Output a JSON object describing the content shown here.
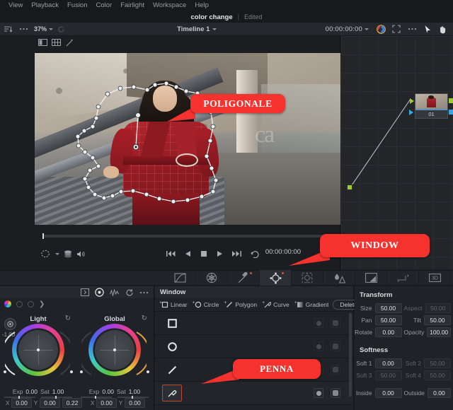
{
  "menubar": {
    "items": [
      {
        "label": "View"
      },
      {
        "label": "Playback"
      },
      {
        "label": "Fusion"
      },
      {
        "label": "Color"
      },
      {
        "label": "Fairlight"
      },
      {
        "label": "Workspace"
      },
      {
        "label": "Help"
      }
    ]
  },
  "titlebar": {
    "project_name": "color change",
    "separator": "|",
    "state": "Edited"
  },
  "toolbar": {
    "zoom_level": "37%",
    "timeline_name": "Timeline 1",
    "timecode": "00:00:00:00"
  },
  "viewer": {
    "timecode": "00:00:00:00",
    "annotations": [
      {
        "id": "poligonale",
        "label": "POLIGONALE",
        "color": "#f6322e"
      },
      {
        "id": "window",
        "label": "WINDOW",
        "color": "#f6322e"
      },
      {
        "id": "penna",
        "label": "PENNA",
        "color": "#f6322e"
      }
    ],
    "store_sign": "ca"
  },
  "nodes": {
    "items": [
      {
        "label": "01"
      }
    ]
  },
  "palette_tools": [
    {
      "name": "curves-tool",
      "active": false,
      "badge": false
    },
    {
      "name": "color-warper-tool",
      "active": false,
      "badge": false
    },
    {
      "name": "qualifier-tool",
      "active": false,
      "badge": true
    },
    {
      "name": "window-tool",
      "active": true,
      "badge": true
    },
    {
      "name": "tracker-tool",
      "active": false,
      "badge": false
    },
    {
      "name": "blur-tool",
      "active": false,
      "badge": false
    },
    {
      "name": "key-tool",
      "active": false,
      "badge": false
    },
    {
      "name": "sizing-tool",
      "active": false,
      "badge": false
    },
    {
      "name": "stereo-3d-tool",
      "active": false,
      "badge": false
    }
  ],
  "color_wheels": {
    "wheels": [
      {
        "name": "Light",
        "lift_value": "-1.00",
        "exp_label": "Exp",
        "exp_value": "0.00",
        "sat_label": "Sat",
        "sat_value": "1.00",
        "x_label": "X",
        "x_value": "0.00",
        "y_label": "Y",
        "y_value": "0.00",
        "extra_value": "0.22"
      },
      {
        "name": "Global",
        "lift_value": "",
        "exp_label": "Exp",
        "exp_value": "0.00",
        "sat_label": "Sat",
        "sat_value": "1.00",
        "x_label": "X",
        "x_value": "0.00",
        "y_label": "Y",
        "y_value": "0.00",
        "extra_value": ""
      }
    ]
  },
  "window_panel": {
    "title": "Window",
    "shape_buttons": [
      {
        "label": "Linear",
        "icon": "square-icon"
      },
      {
        "label": "Circle",
        "icon": "circle-icon"
      },
      {
        "label": "Polygon",
        "icon": "line-icon"
      },
      {
        "label": "Curve",
        "icon": "pen-icon"
      },
      {
        "label": "Gradient",
        "icon": "gradient-icon"
      }
    ],
    "delete_label": "Delete",
    "rows": [
      {
        "icon": "square-icon",
        "selected": false,
        "enabled": false
      },
      {
        "icon": "circle-icon",
        "selected": false,
        "enabled": false
      },
      {
        "icon": "line-icon",
        "selected": false,
        "enabled": false
      },
      {
        "icon": "pen-icon",
        "selected": true,
        "enabled": true
      }
    ]
  },
  "transform": {
    "title": "Transform",
    "rows": [
      {
        "left_label": "Size",
        "left_value": "50.00",
        "left_dim": false,
        "right_label": "Aspect",
        "right_value": "50.00",
        "right_dim": true
      },
      {
        "left_label": "Pan",
        "left_value": "50.00",
        "left_dim": false,
        "right_label": "Tilt",
        "right_value": "50.00",
        "right_dim": false
      },
      {
        "left_label": "Rotate",
        "left_value": "0.00",
        "left_dim": false,
        "right_label": "Opacity",
        "right_value": "100.00",
        "right_dim": false
      }
    ]
  },
  "softness": {
    "title": "Softness",
    "rows": [
      {
        "left_label": "Soft 1",
        "left_value": "0.00",
        "left_dim": false,
        "right_label": "Soft 2",
        "right_value": "50.00",
        "right_dim": true
      },
      {
        "left_label": "Soft 3",
        "left_value": "50.00",
        "left_dim": true,
        "right_label": "Soft 4",
        "right_value": "50.00",
        "right_dim": true
      },
      {
        "left_label": "Inside",
        "left_value": "0.00",
        "left_dim": false,
        "right_label": "Outside",
        "right_value": "0.00",
        "right_dim": false
      }
    ]
  }
}
